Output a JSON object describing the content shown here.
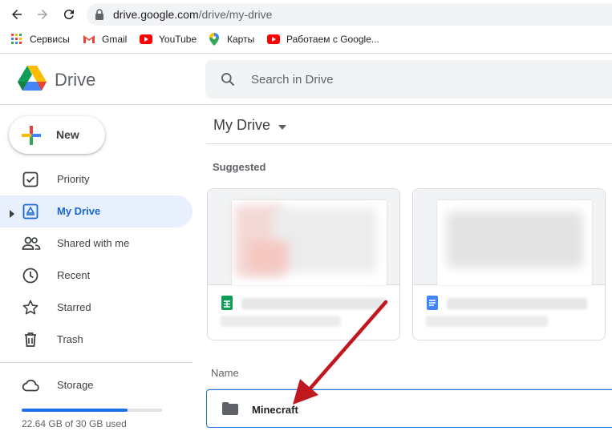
{
  "browser": {
    "url_host": "drive.google.com",
    "url_path": "/drive/my-drive",
    "bookmarks": [
      {
        "label": "Сервисы",
        "icon": "apps-grid-icon"
      },
      {
        "label": "Gmail",
        "icon": "gmail-icon"
      },
      {
        "label": "YouTube",
        "icon": "youtube-icon"
      },
      {
        "label": "Карты",
        "icon": "maps-pin-icon"
      },
      {
        "label": "Работаем с Google...",
        "icon": "youtube-icon"
      }
    ]
  },
  "app": {
    "logo_text": "Drive",
    "search_placeholder": "Search in Drive"
  },
  "sidebar": {
    "new_label": "New",
    "items": [
      {
        "label": "Priority",
        "icon": "priority-check-icon",
        "active": false
      },
      {
        "label": "My Drive",
        "icon": "my-drive-icon",
        "active": true
      },
      {
        "label": "Shared with me",
        "icon": "shared-people-icon",
        "active": false
      },
      {
        "label": "Recent",
        "icon": "clock-icon",
        "active": false
      },
      {
        "label": "Starred",
        "icon": "star-icon",
        "active": false
      },
      {
        "label": "Trash",
        "icon": "trash-icon",
        "active": false
      }
    ],
    "storage_label": "Storage",
    "storage_used_text": "22.64 GB of 30 GB used",
    "storage_fraction": 0.755
  },
  "main": {
    "title": "My Drive",
    "suggested_label": "Suggested",
    "suggested_cards": [
      {
        "file_type": "sheets-icon"
      },
      {
        "file_type": "docs-icon"
      }
    ],
    "list_header": "Name",
    "files": [
      {
        "name": "Minecraft",
        "icon": "folder-icon"
      }
    ]
  },
  "colors": {
    "accent": "#1a73e8",
    "active_bg": "#e8f0fe",
    "arrow": "#c0181f"
  }
}
